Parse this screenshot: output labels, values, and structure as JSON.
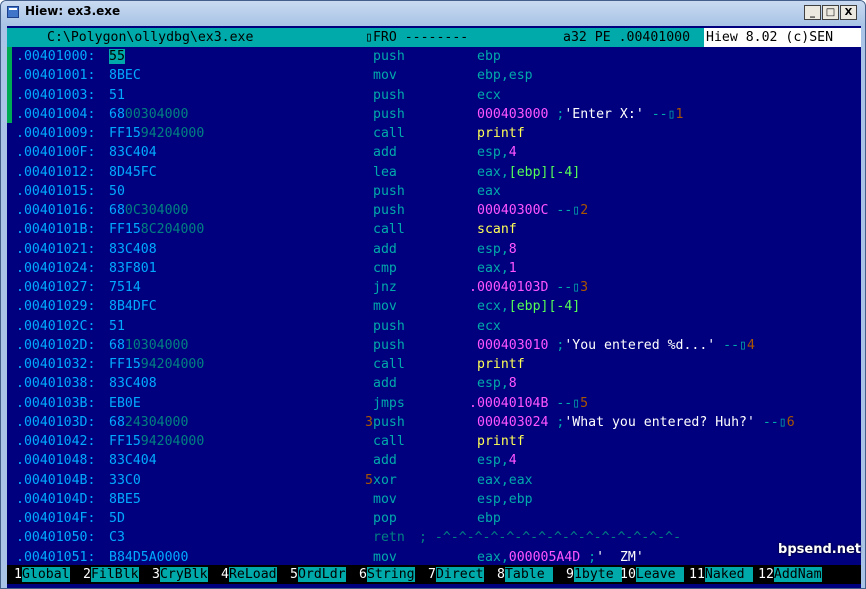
{
  "window": {
    "title": "Hiew: ex3.exe",
    "buttons": [
      "_",
      "□",
      "X"
    ]
  },
  "status_bar": {
    "path": "C:\\Polygon\\ollydbg\\ex3.exe",
    "mode": "▯FRO --------",
    "info": "a32 PE .00401000",
    "version": "Hiew 8.02 (c)SEN"
  },
  "colors": {
    "background": "#00007f",
    "address": "#00aaff",
    "mnemonic": "#00aaaa",
    "immediate": "#ff55ff",
    "function": "#ffff55",
    "string": "#ffffff",
    "memref": "#55ff55",
    "status": "#00aaaa"
  },
  "lines": [
    {
      "addr": ".00401000:",
      "bytes": [
        {
          "t": "55",
          "c": "cur"
        }
      ],
      "pre": "",
      "mn": "push",
      "ops": [
        {
          "t": "ebp"
        }
      ]
    },
    {
      "addr": ".00401001:",
      "bytes": [
        {
          "t": "8BEC"
        }
      ],
      "pre": "",
      "mn": "mov",
      "ops": [
        {
          "t": "ebp,esp"
        }
      ]
    },
    {
      "addr": ".00401003:",
      "bytes": [
        {
          "t": "51"
        }
      ],
      "pre": "",
      "mn": "push",
      "ops": [
        {
          "t": "ecx"
        }
      ]
    },
    {
      "addr": ".00401004:",
      "bytes": [
        {
          "t": "68"
        },
        {
          "t": "00304000",
          "c": "dim"
        }
      ],
      "pre": "",
      "mn": "push",
      "ops": [
        {
          "t": "000403000",
          "c": "m"
        },
        {
          "t": " ;"
        },
        {
          "t": "'Enter X:'",
          "c": "w"
        },
        {
          "t": " --▯"
        },
        {
          "t": "1",
          "c": "lblnum"
        }
      ]
    },
    {
      "addr": ".00401009:",
      "bytes": [
        {
          "t": "FF15"
        },
        {
          "t": "94204000",
          "c": "dim"
        }
      ],
      "pre": "",
      "mn": "call",
      "ops": [
        {
          "t": "printf",
          "c": "y"
        }
      ]
    },
    {
      "addr": ".0040100F:",
      "bytes": [
        {
          "t": "83C404"
        }
      ],
      "pre": "",
      "mn": "add",
      "ops": [
        {
          "t": "esp,"
        },
        {
          "t": "4",
          "c": "m"
        }
      ]
    },
    {
      "addr": ".00401012:",
      "bytes": [
        {
          "t": "8D45FC"
        }
      ],
      "pre": "",
      "mn": "lea",
      "ops": [
        {
          "t": "eax,"
        },
        {
          "t": "[ebp][-4]",
          "c": "g"
        }
      ]
    },
    {
      "addr": ".00401015:",
      "bytes": [
        {
          "t": "50"
        }
      ],
      "pre": "",
      "mn": "push",
      "ops": [
        {
          "t": "eax"
        }
      ]
    },
    {
      "addr": ".00401016:",
      "bytes": [
        {
          "t": "68"
        },
        {
          "t": "0C304000",
          "c": "dim"
        }
      ],
      "pre": "",
      "mn": "push",
      "ops": [
        {
          "t": "00040300C",
          "c": "m"
        },
        {
          "t": " --▯"
        },
        {
          "t": "2",
          "c": "lblnum"
        }
      ]
    },
    {
      "addr": ".0040101B:",
      "bytes": [
        {
          "t": "FF15"
        },
        {
          "t": "8C204000",
          "c": "dim"
        }
      ],
      "pre": "",
      "mn": "call",
      "ops": [
        {
          "t": "scanf",
          "c": "y"
        }
      ]
    },
    {
      "addr": ".00401021:",
      "bytes": [
        {
          "t": "83C408"
        }
      ],
      "pre": "",
      "mn": "add",
      "ops": [
        {
          "t": "esp,"
        },
        {
          "t": "8",
          "c": "m"
        }
      ]
    },
    {
      "addr": ".00401024:",
      "bytes": [
        {
          "t": "83F801"
        }
      ],
      "pre": "",
      "mn": "cmp",
      "ops": [
        {
          "t": "eax,"
        },
        {
          "t": "1",
          "c": "m"
        }
      ]
    },
    {
      "addr": ".00401027:",
      "bytes": [
        {
          "t": "7514"
        }
      ],
      "pre": "",
      "mn": "jnz",
      "ops": [
        {
          "t": ".00040103D",
          "c": "m"
        },
        {
          "t": " --▯"
        },
        {
          "t": "3",
          "c": "lblnum"
        }
      ],
      "opsShift": -8
    },
    {
      "addr": ".00401029:",
      "bytes": [
        {
          "t": "8B4DFC"
        }
      ],
      "pre": "",
      "mn": "mov",
      "ops": [
        {
          "t": "ecx,"
        },
        {
          "t": "[ebp][-4]",
          "c": "g"
        }
      ]
    },
    {
      "addr": ".0040102C:",
      "bytes": [
        {
          "t": "51"
        }
      ],
      "pre": "",
      "mn": "push",
      "ops": [
        {
          "t": "ecx"
        }
      ]
    },
    {
      "addr": ".0040102D:",
      "bytes": [
        {
          "t": "68"
        },
        {
          "t": "10304000",
          "c": "dim"
        }
      ],
      "pre": "",
      "mn": "push",
      "ops": [
        {
          "t": "000403010",
          "c": "m"
        },
        {
          "t": " ;"
        },
        {
          "t": "'You entered %d...'",
          "c": "w"
        },
        {
          "t": " --▯"
        },
        {
          "t": "4",
          "c": "lblnum"
        }
      ]
    },
    {
      "addr": ".00401032:",
      "bytes": [
        {
          "t": "FF15"
        },
        {
          "t": "94204000",
          "c": "dim"
        }
      ],
      "pre": "",
      "mn": "call",
      "ops": [
        {
          "t": "printf",
          "c": "y"
        }
      ]
    },
    {
      "addr": ".00401038:",
      "bytes": [
        {
          "t": "83C408"
        }
      ],
      "pre": "",
      "mn": "add",
      "ops": [
        {
          "t": "esp,"
        },
        {
          "t": "8",
          "c": "m"
        }
      ]
    },
    {
      "addr": ".0040103B:",
      "bytes": [
        {
          "t": "EB0E"
        }
      ],
      "pre": "",
      "mn": "jmps",
      "ops": [
        {
          "t": ".00040104B",
          "c": "m"
        },
        {
          "t": " --▯"
        },
        {
          "t": "5",
          "c": "lblnum"
        }
      ],
      "opsShift": -8
    },
    {
      "addr": ".0040103D:",
      "bytes": [
        {
          "t": "68"
        },
        {
          "t": "24304000",
          "c": "dim"
        }
      ],
      "pre": "3",
      "mn": "push",
      "ops": [
        {
          "t": "000403024",
          "c": "m"
        },
        {
          "t": " ;"
        },
        {
          "t": "'What you entered? Huh?'",
          "c": "w"
        },
        {
          "t": " --▯"
        },
        {
          "t": "6",
          "c": "lblnum"
        }
      ]
    },
    {
      "addr": ".00401042:",
      "bytes": [
        {
          "t": "FF15"
        },
        {
          "t": "94204000",
          "c": "dim"
        }
      ],
      "pre": "",
      "mn": "call",
      "ops": [
        {
          "t": "printf",
          "c": "y"
        }
      ]
    },
    {
      "addr": ".00401048:",
      "bytes": [
        {
          "t": "83C404"
        }
      ],
      "pre": "",
      "mn": "add",
      "ops": [
        {
          "t": "esp,"
        },
        {
          "t": "4",
          "c": "m"
        }
      ]
    },
    {
      "addr": ".0040104B:",
      "bytes": [
        {
          "t": "33C0"
        }
      ],
      "pre": "5",
      "mn": "xor",
      "ops": [
        {
          "t": "eax,eax"
        }
      ]
    },
    {
      "addr": ".0040104D:",
      "bytes": [
        {
          "t": "8BE5"
        }
      ],
      "pre": "",
      "mn": "mov",
      "ops": [
        {
          "t": "esp,ebp"
        }
      ]
    },
    {
      "addr": ".0040104F:",
      "bytes": [
        {
          "t": "5D"
        }
      ],
      "pre": "",
      "mn": "pop",
      "ops": [
        {
          "t": "ebp"
        }
      ]
    },
    {
      "addr": ".00401050:",
      "bytes": [
        {
          "t": "C3"
        }
      ],
      "pre": "",
      "mn": "retn",
      "mnClass": "dim",
      "ops": [
        {
          "t": "; -^-^-^-^-^-^-^-^-^-^-^-^-^-^-^-",
          "c": "dim"
        }
      ],
      "opsShift": -58
    },
    {
      "addr": ".00401051:",
      "bytes": [
        {
          "t": "B84D5A0000"
        }
      ],
      "pre": "",
      "mn": "mov",
      "ops": [
        {
          "t": "eax,"
        },
        {
          "t": "000005A4D",
          "c": "m"
        },
        {
          "t": " ;"
        },
        {
          "t": "'  ZM'",
          "c": "w"
        }
      ]
    }
  ],
  "fkeys": [
    {
      "n": "1",
      "t": "Global"
    },
    {
      "n": "2",
      "t": "FilBlk"
    },
    {
      "n": "3",
      "t": "CryBlk"
    },
    {
      "n": "4",
      "t": "ReLoad"
    },
    {
      "n": "5",
      "t": "OrdLdr"
    },
    {
      "n": "6",
      "t": "String"
    },
    {
      "n": "7",
      "t": "Direct"
    },
    {
      "n": "8",
      "t": "Table "
    },
    {
      "n": "9",
      "t": "1byte "
    },
    {
      "n": "10",
      "t": "Leave "
    },
    {
      "n": "11",
      "t": "Naked "
    },
    {
      "n": "12",
      "t": "AddNam"
    }
  ],
  "watermark": "bpsend.net"
}
